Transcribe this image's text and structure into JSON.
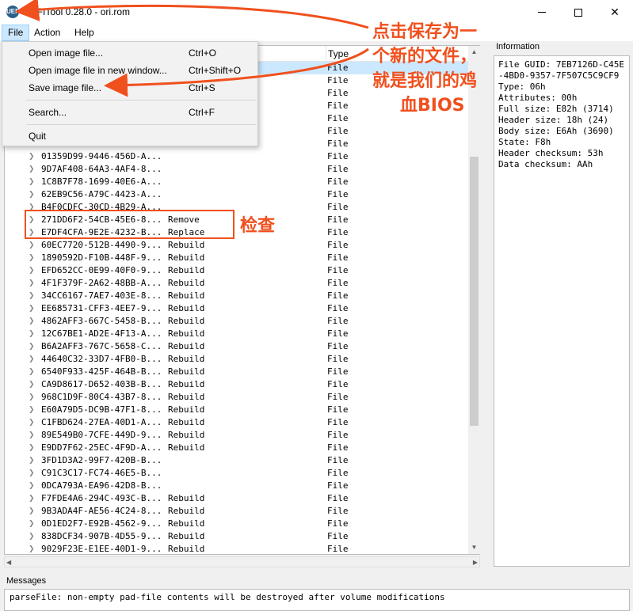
{
  "window": {
    "title": "UEFITool 0.28.0 - ori.rom",
    "app_icon_text": "UEFI"
  },
  "menubar": {
    "file": "File",
    "action": "Action",
    "help": "Help"
  },
  "file_menu": {
    "items": [
      {
        "label": "Open image file...",
        "shortcut": "Ctrl+O"
      },
      {
        "label": "Open image file in new window...",
        "shortcut": "Ctrl+Shift+O"
      },
      {
        "label": "Save image file...",
        "shortcut": "Ctrl+S"
      },
      {
        "label": "Search...",
        "shortcut": "Ctrl+F"
      },
      {
        "label": "Quit",
        "shortcut": ""
      }
    ]
  },
  "structure": {
    "type_header": "Type",
    "rows": [
      {
        "guid": "",
        "action": "",
        "type": "File",
        "selected": true
      },
      {
        "guid": "",
        "action": "",
        "type": "File"
      },
      {
        "guid": "",
        "action": "",
        "type": "File"
      },
      {
        "guid": "",
        "action": "",
        "type": "File"
      },
      {
        "guid": "",
        "action": "",
        "type": "File"
      },
      {
        "guid": "",
        "action": "",
        "type": "File"
      },
      {
        "guid": "",
        "action": "",
        "type": "File"
      },
      {
        "guid": "01359D99-9446-456D-A...",
        "action": "",
        "type": "File"
      },
      {
        "guid": "9D7AF408-64A3-4AF4-8...",
        "action": "",
        "type": "File"
      },
      {
        "guid": "1C8B7F78-1699-40E6-A...",
        "action": "",
        "type": "File"
      },
      {
        "guid": "62EB9C56-A79C-4423-A...",
        "action": "",
        "type": "File"
      },
      {
        "guid": "B4F0CDFC-30CD-4B29-A...",
        "action": "",
        "type": "File"
      },
      {
        "guid": "271DD6F2-54CB-45E6-8...",
        "action": "Remove",
        "type": "File"
      },
      {
        "guid": "E7DF4CFA-9E2E-4232-B...",
        "action": "Replace",
        "type": "File"
      },
      {
        "guid": "60EC7720-512B-4490-9...",
        "action": "Rebuild",
        "type": "File"
      },
      {
        "guid": "1890592D-F10B-448F-9...",
        "action": "Rebuild",
        "type": "File"
      },
      {
        "guid": "EFD652CC-0E99-40F0-9...",
        "action": "Rebuild",
        "type": "File"
      },
      {
        "guid": "4F1F379F-2A62-48BB-A...",
        "action": "Rebuild",
        "type": "File"
      },
      {
        "guid": "34CC6167-7AE7-403E-8...",
        "action": "Rebuild",
        "type": "File"
      },
      {
        "guid": "EE685731-CFF3-4EE7-9...",
        "action": "Rebuild",
        "type": "File"
      },
      {
        "guid": "4862AFF3-667C-5458-B...",
        "action": "Rebuild",
        "type": "File"
      },
      {
        "guid": "12C67BE1-AD2E-4F13-A...",
        "action": "Rebuild",
        "type": "File"
      },
      {
        "guid": "B6A2AFF3-767C-5658-C...",
        "action": "Rebuild",
        "type": "File"
      },
      {
        "guid": "44640C32-33D7-4FB0-B...",
        "action": "Rebuild",
        "type": "File"
      },
      {
        "guid": "6540F933-425F-464B-B...",
        "action": "Rebuild",
        "type": "File"
      },
      {
        "guid": "CA9D8617-D652-403B-B...",
        "action": "Rebuild",
        "type": "File"
      },
      {
        "guid": "968C1D9F-80C4-43B7-8...",
        "action": "Rebuild",
        "type": "File"
      },
      {
        "guid": "E60A79D5-DC9B-47F1-8...",
        "action": "Rebuild",
        "type": "File"
      },
      {
        "guid": "C1FBD624-27EA-40D1-A...",
        "action": "Rebuild",
        "type": "File"
      },
      {
        "guid": "89E549B0-7CFE-449D-9...",
        "action": "Rebuild",
        "type": "File"
      },
      {
        "guid": "E9DD7F62-25EC-4F9D-A...",
        "action": "Rebuild",
        "type": "File"
      },
      {
        "guid": "3FD1D3A2-99F7-420B-B...",
        "action": "",
        "type": "File"
      },
      {
        "guid": "C91C3C17-FC74-46E5-B...",
        "action": "",
        "type": "File"
      },
      {
        "guid": "0DCA793A-EA96-42D8-B...",
        "action": "",
        "type": "File"
      },
      {
        "guid": "F7FDE4A6-294C-493C-B...",
        "action": "Rebuild",
        "type": "File"
      },
      {
        "guid": "9B3ADA4F-AE56-4C24-8...",
        "action": "Rebuild",
        "type": "File"
      },
      {
        "guid": "0D1ED2F7-E92B-4562-9...",
        "action": "Rebuild",
        "type": "File"
      },
      {
        "guid": "838DCF34-907B-4D55-9...",
        "action": "Rebuild",
        "type": "File"
      },
      {
        "guid": "9029F23E-E1EE-40D1-9...",
        "action": "Rebuild",
        "type": "File"
      }
    ]
  },
  "information": {
    "label": "Information",
    "text": "File GUID: 7EB7126D-C45E-4BD0-9357-7F507C5C9CF9\nType: 06h\nAttributes: 00h\nFull size: E82h (3714)\nHeader size: 18h (24)\nBody size: E6Ah (3690)\nState: F8h\nHeader checksum: 53h\nData checksum: AAh"
  },
  "messages": {
    "label": "Messages",
    "text": "parseFile: non-empty pad-file contents will be destroyed after volume modifications"
  },
  "annotations": {
    "save_note_lines": [
      "点击保存为一",
      "个新的文件，",
      "就是我们的鸡",
      "血BIOS"
    ],
    "check_note": "检查",
    "color": "#f0501e"
  }
}
